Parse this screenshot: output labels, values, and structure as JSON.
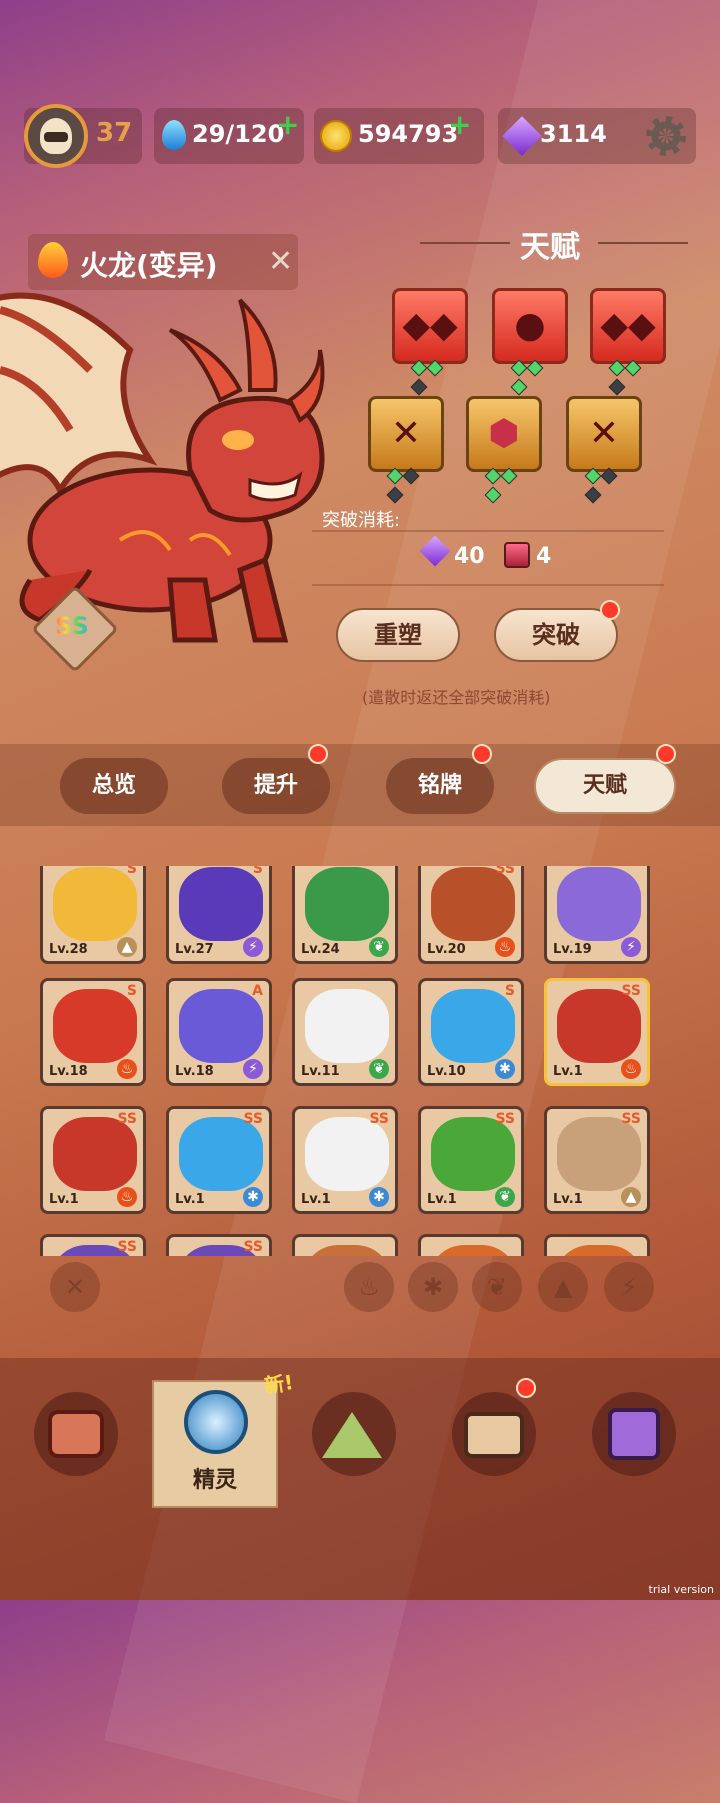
{
  "status": {
    "player_level": "37",
    "stamina": "29/120",
    "coins": "594793",
    "gems": "3114"
  },
  "monster": {
    "name": "火龙(变异)",
    "grade": "SS"
  },
  "talent": {
    "title": "天赋",
    "skills_row1": [
      {
        "icon": "twin-fang-icon",
        "type": "red",
        "pips": [
          true,
          true,
          false
        ]
      },
      {
        "icon": "drop-orb-icon",
        "type": "red",
        "pips": [
          true,
          true,
          true
        ]
      },
      {
        "icon": "twin-fang-icon",
        "type": "red",
        "pips": [
          true,
          true,
          false
        ]
      }
    ],
    "skills_row2": [
      {
        "icon": "slash-cross-icon",
        "type": "gold",
        "pips": [
          true,
          false,
          false
        ]
      },
      {
        "icon": "hex-shield-icon",
        "type": "gold",
        "pips": [
          true,
          true,
          true
        ]
      },
      {
        "icon": "slash-cross-icon",
        "type": "gold",
        "pips": [
          true,
          false,
          false
        ]
      }
    ],
    "cost_label": "突破消耗:",
    "cost_gems": "40",
    "cost_books": "4",
    "reshape_button": "重塑",
    "breakthrough_button": "突破",
    "note": "(遣散时返还全部突破消耗)"
  },
  "tabs": [
    {
      "label": "总览",
      "dot": false,
      "active": false
    },
    {
      "label": "提升",
      "dot": true,
      "active": false
    },
    {
      "label": "铭牌",
      "dot": true,
      "active": false
    },
    {
      "label": "天赋",
      "dot": true,
      "active": true
    }
  ],
  "grid": {
    "rows": [
      [
        {
          "lv": "Lv.28",
          "rank": "S",
          "el": "rock",
          "color": "#f1b83a"
        },
        {
          "lv": "Lv.27",
          "rank": "S",
          "el": "thunder",
          "color": "#5a3ab8"
        },
        {
          "lv": "Lv.24",
          "rank": "",
          "el": "grass",
          "color": "#3a9a4a"
        },
        {
          "lv": "Lv.20",
          "rank": "SS",
          "el": "fire",
          "color": "#b8502a"
        },
        {
          "lv": "Lv.19",
          "rank": "",
          "el": "thunder",
          "color": "#8a6ad8"
        }
      ],
      [
        {
          "lv": "Lv.18",
          "rank": "S",
          "el": "fire",
          "color": "#d83a2a"
        },
        {
          "lv": "Lv.18",
          "rank": "A",
          "el": "thunder",
          "color": "#6a5ad8"
        },
        {
          "lv": "Lv.11",
          "rank": "",
          "el": "grass",
          "color": "#f2f2f2"
        },
        {
          "lv": "Lv.10",
          "rank": "S",
          "el": "ice",
          "color": "#3aa8e8"
        },
        {
          "lv": "Lv.1",
          "rank": "SS",
          "el": "fire",
          "color": "#c8382a"
        }
      ],
      [
        {
          "lv": "Lv.1",
          "rank": "SS",
          "el": "fire",
          "color": "#c8382a"
        },
        {
          "lv": "Lv.1",
          "rank": "SS",
          "el": "ice",
          "color": "#3aa8e8"
        },
        {
          "lv": "Lv.1",
          "rank": "SS",
          "el": "ice",
          "color": "#f2f2f2"
        },
        {
          "lv": "Lv.1",
          "rank": "SS",
          "el": "grass",
          "color": "#4aa83a"
        },
        {
          "lv": "Lv.1",
          "rank": "SS",
          "el": "rock",
          "color": "#c8a07a"
        }
      ],
      [
        {
          "lv": "",
          "rank": "SS",
          "el": "",
          "color": "#6a4ab8"
        },
        {
          "lv": "",
          "rank": "SS",
          "el": "",
          "color": "#6a4ab8"
        },
        {
          "lv": "",
          "rank": "",
          "el": "",
          "color": "#c8703a"
        },
        {
          "lv": "",
          "rank": "",
          "el": "",
          "color": "#d86a2a"
        },
        {
          "lv": "",
          "rank": "",
          "el": "",
          "color": "#d86a2a"
        }
      ]
    ]
  },
  "filters": [
    "clear-filter-icon",
    "fire-icon",
    "ice-icon",
    "grass-icon",
    "rock-icon",
    "thunder-icon"
  ],
  "nav": {
    "new_tag": "新!",
    "spirit_label": "精灵"
  },
  "watermark": "trial version"
}
